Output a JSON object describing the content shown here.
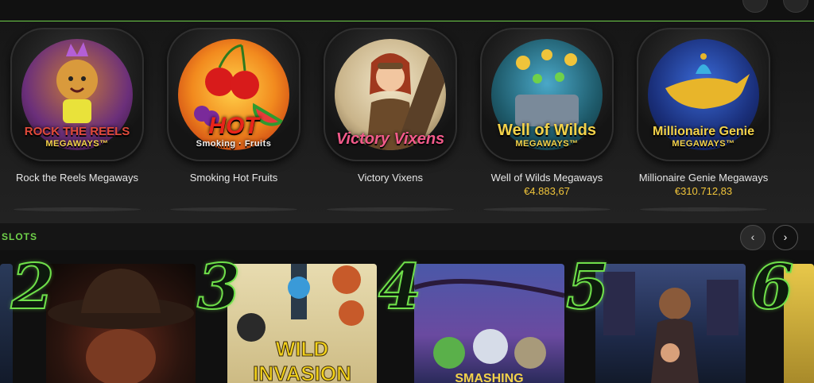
{
  "jackpot_games": [
    {
      "title": "Rock the Reels Megaways",
      "logo": "ROCK THE REELS",
      "logo_sub": "MEGAWAYS™",
      "amount": ""
    },
    {
      "title": "Smoking Hot Fruits",
      "logo": "HOT",
      "logo_sub": "Smoking · Fruits",
      "amount": ""
    },
    {
      "title": "Victory Vixens",
      "logo": "Victory Vixens",
      "logo_sub": "",
      "amount": ""
    },
    {
      "title": "Well of Wilds Megaways",
      "logo": "Well of Wilds",
      "logo_sub": "MEGAWAYS™",
      "amount": "€4.883,67"
    },
    {
      "title": "Millionaire Genie Megaways",
      "logo": "Millionaire Genie",
      "logo_sub": "MEGAWAYS™",
      "amount": "€310.712,83"
    }
  ],
  "section": {
    "title": "SLOTS",
    "prev_icon": "chevron-left-icon",
    "next_icon": "chevron-right-icon",
    "prev_glyph": "‹",
    "next_glyph": "›"
  },
  "top_slots": [
    {
      "rank": "2",
      "label": ""
    },
    {
      "rank": "3",
      "label": "WILD INVASION"
    },
    {
      "rank": "4",
      "label": "SMASHING"
    },
    {
      "rank": "5",
      "label": ""
    },
    {
      "rank": "6",
      "label": ""
    }
  ],
  "colors": {
    "accent": "#6fd14a",
    "amount": "#f0c43a",
    "background": "#1a1a1a"
  }
}
